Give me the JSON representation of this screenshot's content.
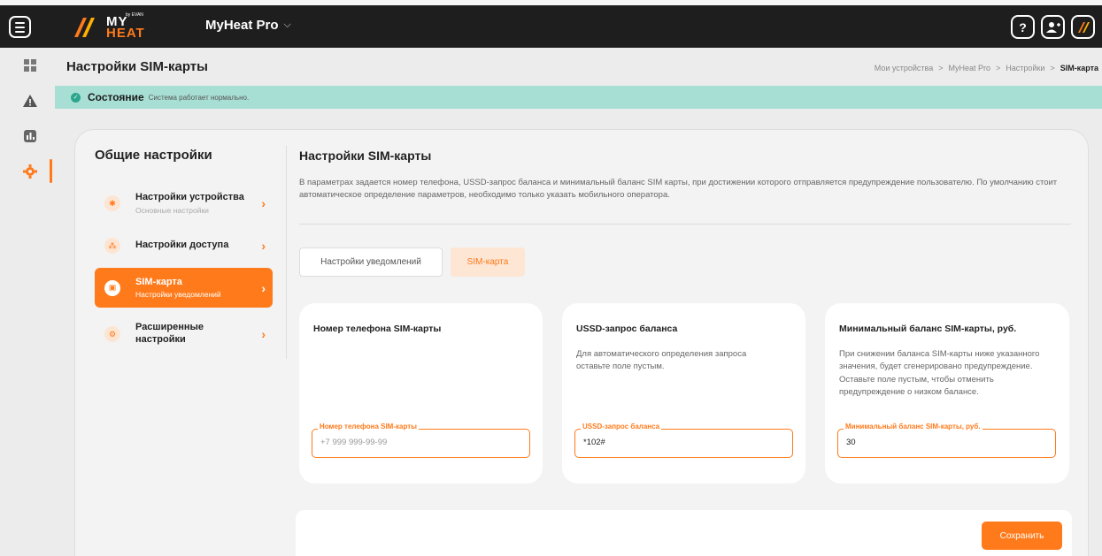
{
  "header": {
    "logo": {
      "by": "by EVAN",
      "line1": "MY",
      "line2": "HEAT"
    },
    "device": "MyHeat Pro",
    "icons": [
      "help-icon",
      "add-user-icon",
      "brand-icon"
    ]
  },
  "page": {
    "title": "Настройки SIM-карты",
    "breadcrumbs": [
      "Мои устройства",
      "MyHeat Pro",
      "Настройки",
      "SIM-карта"
    ],
    "breadcrumb_sep": ">"
  },
  "status": {
    "title": "Состояние",
    "text": "Система работает нормально."
  },
  "left": {
    "title": "Общие настройки",
    "items": [
      {
        "label": "Настройки устройства",
        "sub": "Основные настройки"
      },
      {
        "label": "Настройки доступа",
        "sub": ""
      },
      {
        "label": "SIM-карта",
        "sub": "Настройки уведомлений"
      },
      {
        "label": "Расширенные настройки",
        "sub": ""
      }
    ]
  },
  "section": {
    "title": "Настройки SIM-карты",
    "description": "В параметрах задается номер телефона, USSD-запрос баланса и минимальный баланс SIM карты, при достижении которого отправляется предупреждение пользователю. По умолчанию стоит автоматическое определение параметров, необходимо только указать мобильного оператора."
  },
  "tabs": {
    "notifications": "Настройки уведомлений",
    "sim": "SIM-карта"
  },
  "cards": {
    "phone": {
      "title": "Номер телефона SIM-карты",
      "field_label": "Номер телефона SIM-карты",
      "placeholder": "+7 999 999-99-99",
      "value": ""
    },
    "ussd": {
      "title": "USSD-запрос баланса",
      "description": "Для автоматического определения запроса оставьте поле пустым.",
      "field_label": "USSD-запрос баланса",
      "value": "*102#"
    },
    "min_balance": {
      "title": "Минимальный баланс SIM-карты, руб.",
      "description": "При снижении баланса SIM-карты ниже указанного значения, будет сгенерировано предупреждение. Оставьте поле пустым, чтобы отменить предупреждение о низком балансе.",
      "field_label": "Минимальный баланс SIM-карты, руб.",
      "value": "30"
    }
  },
  "actions": {
    "save": "Сохранить"
  },
  "colors": {
    "accent": "#ff7a1a",
    "status_bg": "#a8dfd5",
    "status_ok": "#2ca58d",
    "topbar": "#1e1e1e"
  }
}
